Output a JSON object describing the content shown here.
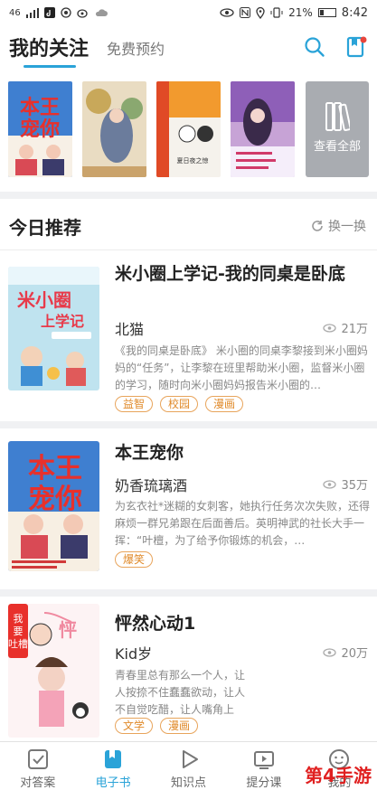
{
  "status_bar": {
    "signal": "46",
    "battery": "21%",
    "time": "8:42"
  },
  "header": {
    "tab_main": "我的关注",
    "tab_sub": "免费预约"
  },
  "shelf": {
    "view_all": "查看全部"
  },
  "today": {
    "title": "今日推荐",
    "refresh": "换一换",
    "books": [
      {
        "title": "米小圈上学记-我的同桌是卧底",
        "author": "北猫",
        "views": "21万",
        "desc": "《我的同桌是卧底》 米小圈的同桌李黎接到米小圈妈妈的“任务”，让李黎在班里帮助米小圈，监督米小圈的学习，随时向米小圈妈妈报告米小圈的…",
        "tags": [
          "益智",
          "校园",
          "漫画"
        ]
      },
      {
        "title": "本王宠你",
        "author": "奶香琉璃酒",
        "views": "35万",
        "desc": "为玄衣社*迷糊的女刺客，她执行任务次次失败，还得麻烦一群兄弟跟在后面善后。英明神武的社长大手一挥：“叶檀，为了给予你锻炼的机会，…",
        "tags": [
          "爆笑"
        ]
      },
      {
        "title": "怦然心动1",
        "author": "Kid岁",
        "views": "20万",
        "desc": "青春里总有那么一个人，让人按捺不住蠢蠢欲动，让人不自觉吃醋，让人嘴角上扬……",
        "tags": [
          "文学",
          "漫画"
        ]
      }
    ]
  },
  "bottom_nav": {
    "items": [
      {
        "label": "对答案"
      },
      {
        "label": "电子书"
      },
      {
        "label": "知识点"
      },
      {
        "label": "提分课"
      },
      {
        "label": "我的"
      }
    ]
  },
  "watermark": "第4手游",
  "colors": {
    "accent": "#2aa3d8",
    "tag": "#e08a2a"
  }
}
